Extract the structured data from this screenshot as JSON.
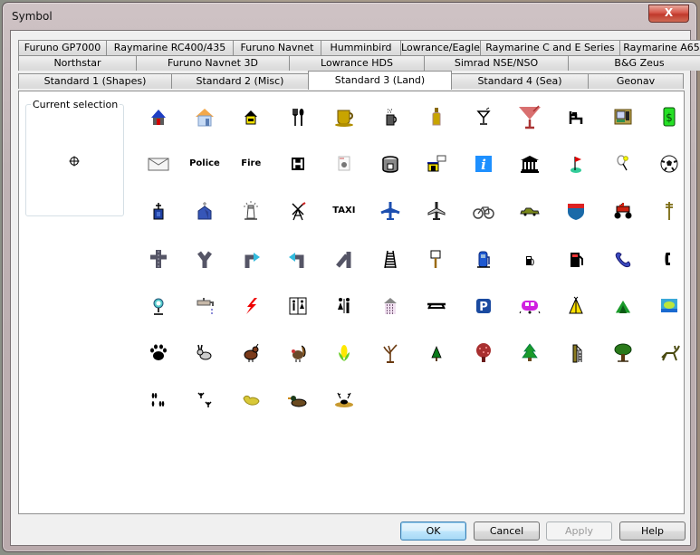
{
  "window": {
    "title": "Symbol",
    "close_label": "X"
  },
  "tabs": {
    "row1": [
      "Furuno GP7000",
      "Raymarine RC400/435",
      "Furuno Navnet",
      "Humminbird",
      "Lowrance/Eagle",
      "Raymarine C and E Series",
      "Raymarine A65"
    ],
    "row2": [
      "Northstar",
      "Furuno Navnet 3D",
      "Lowrance HDS",
      "Simrad NSE/NSO",
      "B&G Zeus"
    ],
    "row3": [
      "Standard 1 (Shapes)",
      "Standard 2 (Misc)",
      "Standard 3 (Land)",
      "Standard 4 (Sea)",
      "Geonav"
    ],
    "active": "Standard 3 (Land)"
  },
  "current_selection": {
    "label": "Current selection",
    "symbol": "crosshair-circle"
  },
  "symbols": [
    "house-blue",
    "house-orange",
    "house-yellow",
    "restaurant-fork-spoon",
    "coffee-cup-gold",
    "hot-drink-mug",
    "bottle",
    "martini-glass",
    "cocktail-bar-red",
    "lodging-bed",
    "atm-machine",
    "dollar-bill",
    "mail-envelope",
    "Police",
    "Fire",
    "hospital-H",
    "washing-machine",
    "hotel-drum",
    "store-with-sign",
    "information",
    "bank-building",
    "golf-flag",
    "tennis-racket",
    "soccer-ball",
    "church-small",
    "chapel",
    "lighthouse",
    "windmill",
    "TAXI",
    "airport-blue",
    "airplane-gray",
    "bicycle",
    "car",
    "interstate-shield",
    "atv-quad",
    "power-pole",
    "road-crossing",
    "road-fork",
    "turn-right",
    "turn-left",
    "road-merge",
    "railroad-track",
    "signpost",
    "gas-pump-blue",
    "fuel-small",
    "fuel-red",
    "telephone-blue",
    "telephone-black",
    "water-fountain",
    "water-faucet",
    "lightning",
    "restrooms-box",
    "restrooms",
    "shower",
    "picnic-table",
    "parking",
    "camper-trailer",
    "tent-yellow",
    "tent-green",
    "scenic-view",
    "paw-print",
    "rabbit",
    "quail",
    "turkey",
    "corn",
    "bare-tree",
    "small-pine",
    "flowering-tree",
    "pine-tree",
    "tree-stand",
    "oak-tree",
    "deer",
    "hoof-tracks",
    "bird-tracks",
    "duck-yellow",
    "duck-decoy",
    "deer-in-nest"
  ],
  "buttons": {
    "ok": "OK",
    "cancel": "Cancel",
    "apply": "Apply",
    "help": "Help"
  },
  "colors": {
    "window_frame": "#bfb3b5",
    "client_bg": "#f0f0f0",
    "panel_bg": "#ffffff",
    "close_button": "#c0392b",
    "default_button": "#bee6fd"
  }
}
